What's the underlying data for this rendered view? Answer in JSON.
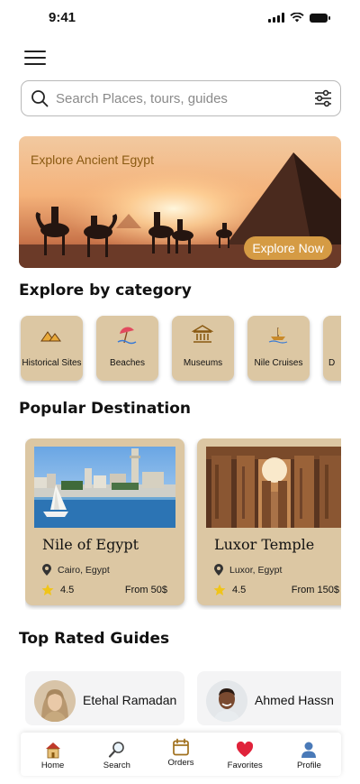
{
  "status_bar": {
    "time": "9:41"
  },
  "search": {
    "placeholder": "Search Places, tours, guides"
  },
  "banner": {
    "title": "Explore Ancient Egypt",
    "button_label": "Explore Now"
  },
  "categories": {
    "title": "Explore by category",
    "items": [
      {
        "label": "Historical Sites",
        "icon": "pyramids-icon"
      },
      {
        "label": "Beaches",
        "icon": "beach-umbrella-icon"
      },
      {
        "label": "Museums",
        "icon": "museum-icon"
      },
      {
        "label": "Nile Cruises",
        "icon": "boat-icon"
      },
      {
        "label": "D",
        "icon": "category-icon"
      }
    ]
  },
  "destinations": {
    "title": "Popular Destination",
    "items": [
      {
        "name": "Nile of Egypt",
        "location": "Cairo, Egypt",
        "rating": "4.5",
        "price": "From 50$"
      },
      {
        "name": "Luxor Temple",
        "location": "Luxor, Egypt",
        "rating": "4.5",
        "price": "From 150$"
      }
    ]
  },
  "guides": {
    "title": "Top Rated Guides",
    "items": [
      {
        "name": "Etehal Ramadan"
      },
      {
        "name": "Ahmed Hassn"
      }
    ]
  },
  "bottom_nav": {
    "items": [
      {
        "label": "Home",
        "icon": "home-icon"
      },
      {
        "label": "Search",
        "icon": "search-icon"
      },
      {
        "label": "Orders",
        "icon": "calendar-icon"
      },
      {
        "label": "Favorites",
        "icon": "heart-icon"
      },
      {
        "label": "Profile",
        "icon": "profile-icon"
      }
    ]
  },
  "colors": {
    "card_beige": "#dcc7a3",
    "accent_gold": "#d59b44",
    "banner_text": "#8a5a12"
  }
}
